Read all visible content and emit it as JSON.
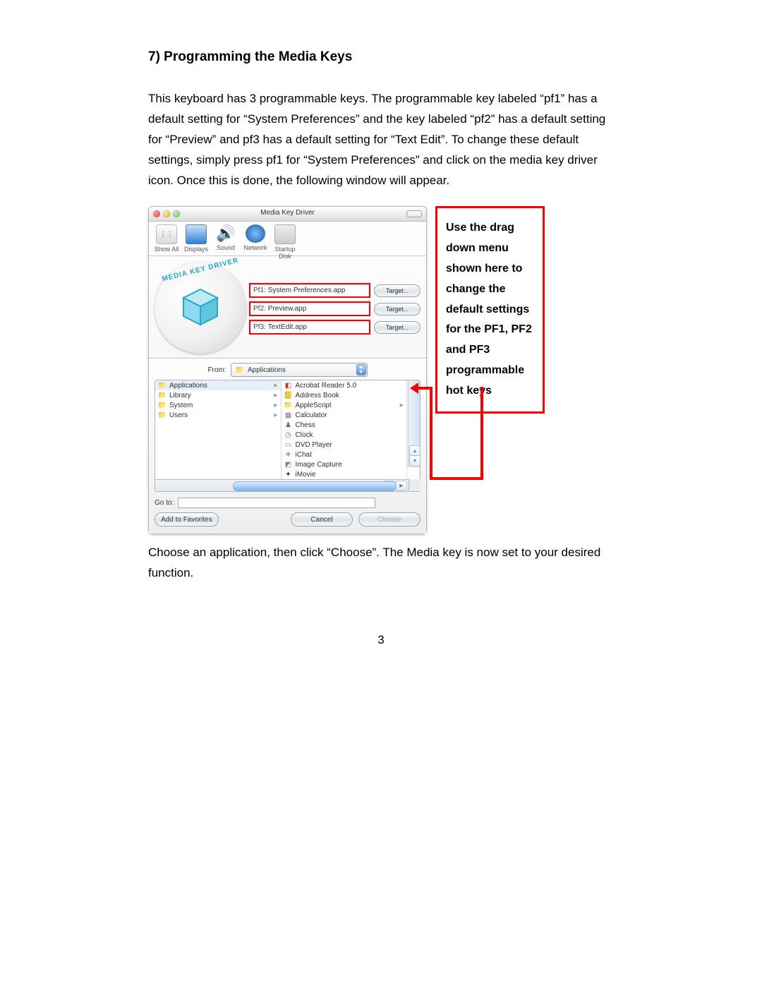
{
  "section_title": "7) Programming the Media Keys",
  "intro_text": "This keyboard has 3 programmable keys. The programmable key labeled “pf1” has a default setting for “System Preferences” and the key labeled “pf2” has a default setting for “Preview” and pf3 has a default setting for “Text Edit”. To change these default settings, simply press pf1 for “System Preferences” and click on the media key driver icon. Once this is done, the following window will appear.",
  "callout_text": "Use the drag down menu shown here to change the default settings for the PF1, PF2 and PF3 programmable hot keys",
  "outro_text": "Choose an application, then click “Choose”. The Media key is now set to your desired function.",
  "page_number": "3",
  "window": {
    "title": "Media Key Driver",
    "toolbar": [
      {
        "label": "Show All"
      },
      {
        "label": "Displays"
      },
      {
        "label": "Sound"
      },
      {
        "label": "Network"
      },
      {
        "label": "Startup Disk"
      }
    ],
    "logo_text": "MEDIA KEY DRIVER",
    "pf_rows": [
      {
        "label": "Pf1:",
        "value": "System Preferences.app",
        "button": "Target..."
      },
      {
        "label": "Pf2:",
        "value": "Preview.app",
        "button": "Target..."
      },
      {
        "label": "Pf3:",
        "value": "TextEdit.app",
        "button": "Target..."
      }
    ],
    "from_label": "From:",
    "from_value": "Applications",
    "column_left": [
      "Applications",
      "Library",
      "System",
      "Users"
    ],
    "column_right": [
      "Acrobat Reader 5.0",
      "Address Book",
      "AppleScript",
      "Calculator",
      "Chess",
      "Clock",
      "DVD Player",
      "iChat",
      "Image Capture",
      "iMovie"
    ],
    "goto_label": "Go to:",
    "add_favorites": "Add to Favorites",
    "cancel": "Cancel",
    "choose": "Choose"
  }
}
